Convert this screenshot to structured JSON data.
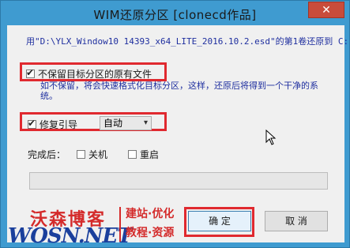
{
  "window": {
    "title": "WIM还原分区  [clonecd作品]",
    "close_glyph": "✕"
  },
  "info_text": "用\"D:\\YLX_Window10 14393_x64_LITE_2016.10.2.esd\"的第1卷还原到 C:",
  "keep_files": {
    "label": "不保留目标分区的原有文件",
    "checked": true,
    "description": "如不保留，将会快速格式化目标分区，这样，还原后将得到一个干净的系统。"
  },
  "repair_boot": {
    "label": "修复引导",
    "checked": true,
    "mode_selected": "自动"
  },
  "after_done": {
    "label": "完成后：",
    "shutdown_label": "关机",
    "restart_label": "重启"
  },
  "progress": {
    "value": 0
  },
  "buttons": {
    "ok_label": "确 定",
    "cancel_label": "取 消"
  },
  "watermark": {
    "brand_cn": "沃森博客",
    "url": "WOSN.NET",
    "tag_top": "建站·优化",
    "tag_bottom": "教程·资源"
  },
  "colors": {
    "title_bar": "#3f9bd0",
    "highlight": "#e0292f",
    "info_text": "#1f2f9f",
    "watermark_red": "#d42b2b",
    "watermark_blue": "#1a3f9c"
  }
}
